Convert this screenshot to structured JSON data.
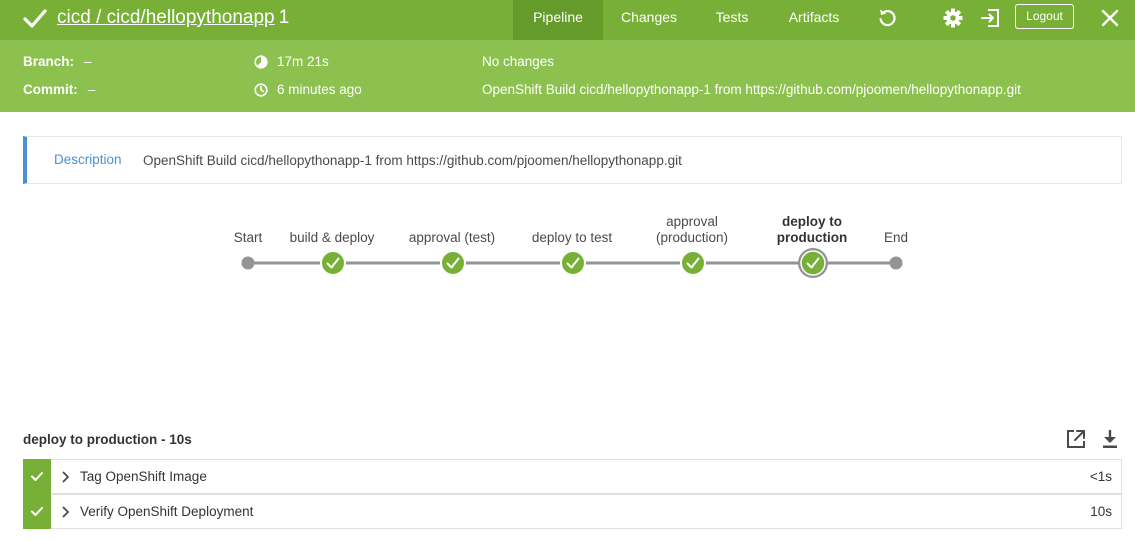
{
  "header": {
    "org": "cicd",
    "separator": " / ",
    "pipeline": "cicd/hellopythonapp",
    "run_number": "1",
    "tabs": [
      {
        "label": "Pipeline",
        "active": true
      },
      {
        "label": "Changes",
        "active": false
      },
      {
        "label": "Tests",
        "active": false
      },
      {
        "label": "Artifacts",
        "active": false
      }
    ],
    "logout_label": "Logout",
    "icons": [
      "checkmark-icon",
      "replay-icon",
      "gear-icon",
      "exit-icon",
      "close-icon"
    ]
  },
  "summary": {
    "branch_label": "Branch:",
    "branch_value": "–",
    "commit_label": "Commit:",
    "commit_value": "–",
    "duration": "17m 21s",
    "finished": "6 minutes ago",
    "changes": "No changes",
    "cause": "OpenShift Build cicd/hellopythonapp-1 from https://github.com/pjoomen/hellopythonapp.git"
  },
  "description": {
    "label": "Description",
    "text": "OpenShift Build cicd/hellopythonapp-1 from https://github.com/pjoomen/hellopythonapp.git"
  },
  "pipeline_graph": {
    "nodes": [
      {
        "label": "Start",
        "label_line2": "",
        "kind": "terminal"
      },
      {
        "label": "build & deploy",
        "label_line2": "",
        "kind": "success"
      },
      {
        "label": "approval (test)",
        "label_line2": "",
        "kind": "success"
      },
      {
        "label": "deploy to test",
        "label_line2": "",
        "kind": "success"
      },
      {
        "label": "approval",
        "label_line2": "(production)",
        "kind": "success"
      },
      {
        "label": "deploy to",
        "label_line2": "production",
        "kind": "success",
        "selected": true
      },
      {
        "label": "End",
        "label_line2": "",
        "kind": "terminal"
      }
    ]
  },
  "steps": {
    "heading": "deploy to production - 10s",
    "items": [
      {
        "name": "Tag OpenShift Image",
        "duration": "<1s",
        "status": "success"
      },
      {
        "name": "Verify OpenShift Deployment",
        "duration": "10s",
        "status": "success"
      }
    ]
  },
  "colors": {
    "header_bg": "#78b037",
    "subheader_bg": "#8cc04f",
    "active_tab": "#649b2b",
    "success": "#78b037",
    "terminal_node": "#949393",
    "edge": "#949393",
    "accent_blue": "#4a90d9"
  }
}
